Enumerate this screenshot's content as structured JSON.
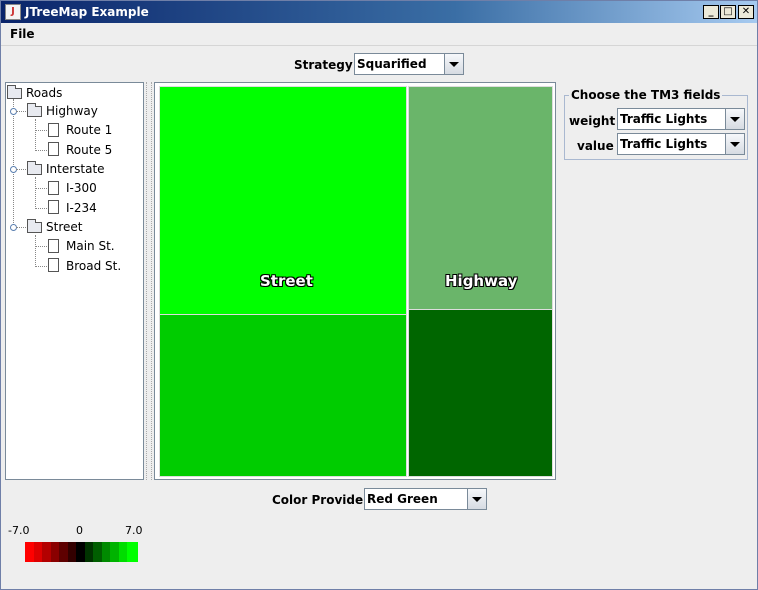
{
  "window": {
    "title": "JTreeMap Example",
    "buttons": {
      "minimize": "_",
      "maximize": "□",
      "close": "✕"
    }
  },
  "menu": {
    "file": "File"
  },
  "strategy": {
    "label": "Strategy :",
    "value": "Squarified"
  },
  "tree": {
    "root": "Roads",
    "groups": [
      {
        "label": "Highway",
        "children": [
          "Route 1",
          "Route 5"
        ]
      },
      {
        "label": "Interstate",
        "children": [
          "I-300",
          "I-234"
        ]
      },
      {
        "label": "Street",
        "children": [
          "Main St.",
          "Broad St."
        ]
      }
    ]
  },
  "treemap": {
    "labels": {
      "street": "Street",
      "highway": "Highway"
    },
    "colors": {
      "street_top": "#00ff00",
      "street_bottom": "#00cc00",
      "highway_top": "#6ab56a",
      "highway_bottom": "#006600"
    }
  },
  "tm3": {
    "legend": "Choose the TM3 fields",
    "weight_label": "weight :",
    "weight_value": "Traffic Lights",
    "value_label": "value :",
    "value_value": "Traffic Lights"
  },
  "color_provider": {
    "label": "Color Provider :",
    "value": "Red Green"
  },
  "scale": {
    "min": "-7.0",
    "mid": "0",
    "max": "7.0",
    "colors": [
      "#ff0000",
      "#dd0000",
      "#b30000",
      "#8a0000",
      "#5e0000",
      "#330000",
      "#000000",
      "#003300",
      "#005e00",
      "#008a00",
      "#00b300",
      "#00dd00",
      "#00ff00"
    ]
  }
}
